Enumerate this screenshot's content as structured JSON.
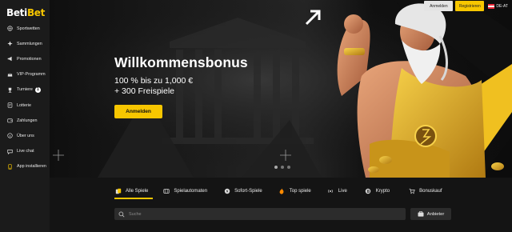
{
  "brand": {
    "part1": "Beti",
    "part2": "Bet",
    "accent": "#f7c600"
  },
  "sidebar": {
    "items": [
      {
        "label": "Sportwetten",
        "icon": "sport-icon"
      },
      {
        "label": "Sammlungen",
        "icon": "sparkle-icon"
      },
      {
        "label": "Promotionen",
        "icon": "megaphone-icon"
      },
      {
        "label": "VIP-Programm",
        "icon": "crown-icon"
      },
      {
        "label": "Turniere",
        "icon": "trophy-icon",
        "badge": "1"
      },
      {
        "label": "Lotterie",
        "icon": "ticket-icon"
      },
      {
        "label": "Zahlungen",
        "icon": "wallet-icon"
      },
      {
        "label": "Über uns",
        "icon": "info-icon"
      },
      {
        "label": "Live chat",
        "icon": "chat-icon"
      },
      {
        "label": "App installieren",
        "icon": "mobile-icon"
      }
    ]
  },
  "header": {
    "login_label": "Anmelden",
    "register_label": "Registrieren",
    "language": "DE-AT"
  },
  "hero": {
    "title": "Willkommensbonus",
    "line1": "100 % bis zu 1,000 €",
    "line2": "+ 300 Freispiele",
    "cta_label": "Anmelden",
    "slides_total": 3,
    "active_slide": 1
  },
  "tabs": [
    {
      "label": "Alle Spiele",
      "icon": "cards-icon",
      "active": true
    },
    {
      "label": "Spielautomaten",
      "icon": "slot-icon"
    },
    {
      "label": "Sofort-Spiele",
      "icon": "instant-icon"
    },
    {
      "label": "Top spiele",
      "icon": "fire-icon"
    },
    {
      "label": "Live",
      "icon": "live-icon"
    },
    {
      "label": "Krypto",
      "icon": "crypto-icon"
    },
    {
      "label": "Bonuskauf",
      "icon": "cart-icon"
    }
  ],
  "search": {
    "placeholder": "Suche"
  },
  "providers": {
    "label": "Anbieter"
  }
}
